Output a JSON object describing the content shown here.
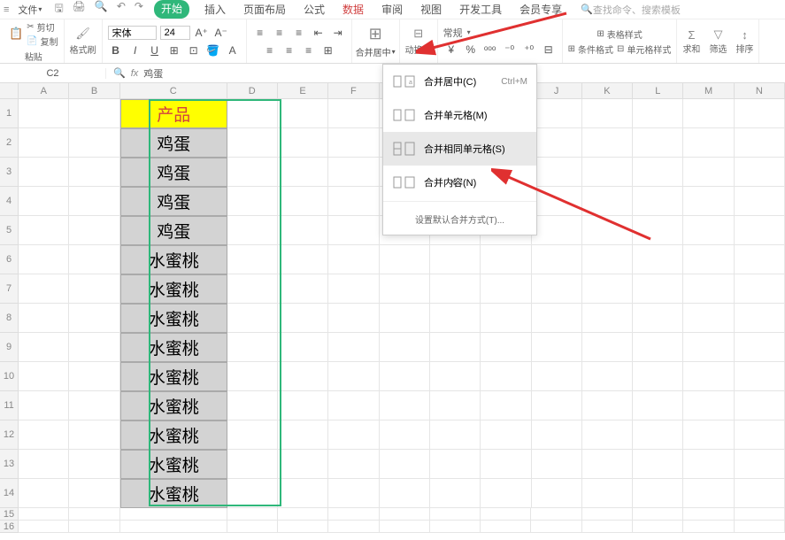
{
  "menu": {
    "file": "文件",
    "tabs": [
      "开始",
      "插入",
      "页面布局",
      "公式",
      "数据",
      "审阅",
      "视图",
      "开发工具",
      "会员专享"
    ],
    "active_tab": 0,
    "highlight_tab": 4,
    "search_placeholder": "查找命令、搜索模板"
  },
  "ribbon": {
    "clipboard": {
      "cut": "剪切",
      "copy": "复制",
      "paste": "粘贴",
      "format_painter": "格式刷"
    },
    "font": {
      "name": "宋体",
      "size": "24"
    },
    "merge": {
      "label": "合并居中"
    },
    "wrap": {
      "label": "动换行"
    },
    "format": {
      "category": "常规"
    },
    "conditional": "条件格式",
    "cell_style": "单元格样式",
    "table_style": "表格样式",
    "sum": "求和",
    "filter": "筛选",
    "sort": "排序"
  },
  "formula_bar": {
    "name_box": "C2",
    "content": "鸡蛋"
  },
  "columns": [
    "A",
    "B",
    "C",
    "D",
    "E",
    "F",
    "G",
    "H",
    "I",
    "J",
    "K",
    "L",
    "M",
    "N"
  ],
  "rows": [
    1,
    2,
    3,
    4,
    5,
    6,
    7,
    8,
    9,
    10,
    11,
    12,
    13,
    14,
    15,
    16
  ],
  "data": {
    "header": "产品",
    "cells": [
      "鸡蛋",
      "鸡蛋",
      "鸡蛋",
      "鸡蛋",
      "水蜜桃",
      "水蜜桃",
      "水蜜桃",
      "水蜜桃",
      "水蜜桃",
      "水蜜桃",
      "水蜜桃",
      "水蜜桃",
      "水蜜桃"
    ]
  },
  "dropdown": {
    "items": [
      {
        "label": "合并居中(C)",
        "shortcut": "Ctrl+M"
      },
      {
        "label": "合并单元格(M)",
        "shortcut": ""
      },
      {
        "label": "合并相同单元格(S)",
        "shortcut": ""
      },
      {
        "label": "合并内容(N)",
        "shortcut": ""
      }
    ],
    "footer": "设置默认合并方式(T)..."
  },
  "chart_data": {
    "type": "table",
    "title": "产品",
    "categories": [
      "产品"
    ],
    "values": [
      "鸡蛋",
      "鸡蛋",
      "鸡蛋",
      "鸡蛋",
      "水蜜桃",
      "水蜜桃",
      "水蜜桃",
      "水蜜桃",
      "水蜜桃",
      "水蜜桃",
      "水蜜桃",
      "水蜜桃",
      "水蜜桃"
    ]
  }
}
